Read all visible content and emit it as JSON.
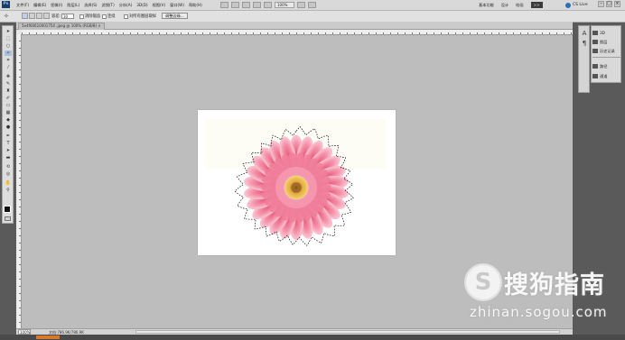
{
  "app": {
    "logo_text": "Ps"
  },
  "menubar": {
    "items": [
      "文件(F)",
      "编辑(E)",
      "图像(I)",
      "图层(L)",
      "选择(S)",
      "滤镜(T)",
      "分析(A)",
      "3D(D)",
      "视图(V)",
      "窗口(W)",
      "帮助(H)"
    ],
    "zoom_level": "100%",
    "workspaces": [
      "基本功能",
      "设计",
      "绘画",
      ">>"
    ],
    "cs_live": "CS Live",
    "window_controls": [
      "–",
      "□",
      "×"
    ]
  },
  "options_bar": {
    "tolerance_label": "容差:",
    "tolerance_value": "30",
    "antialias_label": "消除锯齿",
    "contiguous_label": "连续",
    "sample_all_label": "对所有图层取样",
    "refine_edge_button": "调整边缘..."
  },
  "document": {
    "tab_title": "5e4f60610001754 .jpeg @ 100% (RGB/8) ×",
    "zoom": "100%",
    "doc_info": "文档:786.9K/786.9K"
  },
  "dock": {
    "items": [
      "3D",
      "图层",
      "历史记录",
      "路径",
      "通道"
    ]
  },
  "watermark": {
    "logo_letter": "S",
    "brand_text": "搜狗指南",
    "url": "zhinan.sogou.com"
  },
  "colors": {
    "canvas_bg": "#bdbdbd",
    "flower_petal": "#f48fa8",
    "flower_center": "#e9a43a"
  }
}
